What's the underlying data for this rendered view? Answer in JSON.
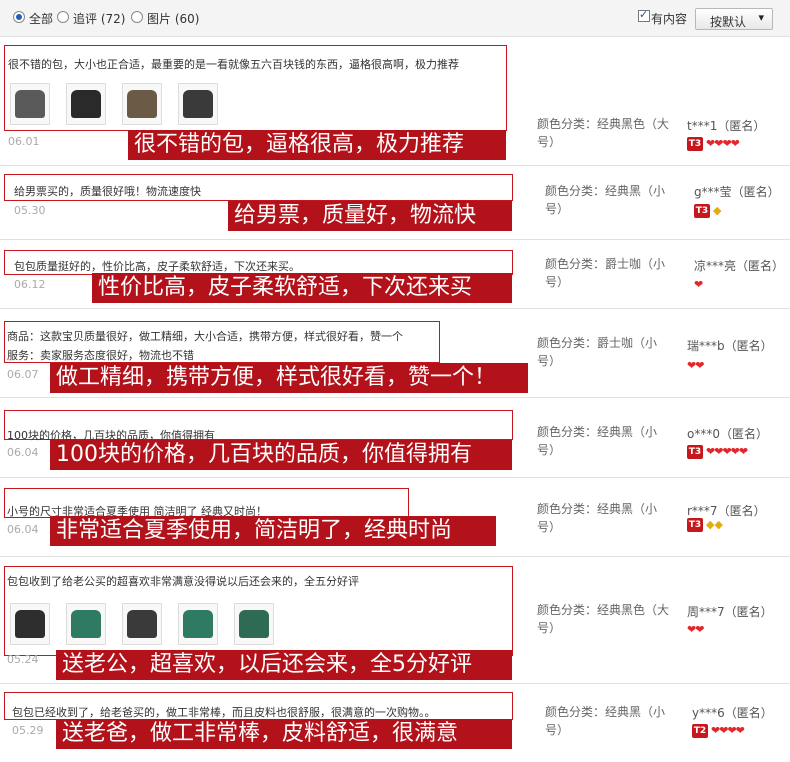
{
  "filters": {
    "all_label": "全部",
    "followup_label": "追评 (72)",
    "pictures_label": "图片 (60)",
    "has_content_label": "有内容",
    "sort_label": "按默认"
  },
  "reviews": [
    {
      "text": "很不错的包，大小也正合适，最重要的是一看就像五六百块钱的东西，逼格很高啊，极力推荐",
      "date": "06.01",
      "banner": "很不错的包，逼格很高，极力推荐",
      "sku_key": "颜色分类：",
      "sku_value": "经典黑色（大号）",
      "buyer": "t***1（匿名）",
      "tier": "T3",
      "hearts": 4,
      "diamonds": 0
    },
    {
      "text": "给男票买的，质量很好哦！物流速度快",
      "date": "05.30",
      "banner": "给男票，质量好，物流快",
      "sku_key": "颜色分类：",
      "sku_value": "经典黑（小号）",
      "buyer": "g***莹（匿名）",
      "tier": "T3",
      "hearts": 0,
      "diamonds": 1
    },
    {
      "text": "包包质量挺好的，性价比高，皮子柔软舒适，下次还来买。",
      "date": "06.12",
      "banner": "性价比高，皮子柔软舒适，下次还来买",
      "sku_key": "颜色分类：",
      "sku_value": "爵士咖（小号）",
      "buyer": "凉***亮（匿名）",
      "tier": "",
      "hearts": 1,
      "diamonds": 0
    },
    {
      "text": "商品：这款宝贝质量很好，做工精细，大小合适，携带方便，样式很好看，赞一个",
      "text2": "服务：卖家服务态度很好，物流也不错",
      "date": "06.07",
      "banner": "做工精细，携带方便，样式很好看，赞一个！",
      "sku_key": "颜色分类：",
      "sku_value": "爵士咖（小号）",
      "buyer": "瑞***b（匿名）",
      "tier": "",
      "hearts": 2,
      "diamonds": 0
    },
    {
      "text": "100块的价格，几百块的品质，你值得拥有",
      "date": "06.04",
      "banner": "100块的价格，几百块的品质，你值得拥有",
      "sku_key": "颜色分类：",
      "sku_value": "经典黑（小号）",
      "buyer": "o***0（匿名）",
      "tier": "T3",
      "hearts": 5,
      "diamonds": 0
    },
    {
      "text": "小号的尺寸非常适合夏季使用 简洁明了 经典又时尚！",
      "date": "06.04",
      "banner": "非常适合夏季使用，简洁明了，经典时尚",
      "sku_key": "颜色分类：",
      "sku_value": "经典黑（小号）",
      "buyer": "r***7（匿名）",
      "tier": "T3",
      "hearts": 0,
      "diamonds": 2
    },
    {
      "text": "包包收到了给老公买的超喜欢非常满意没得说以后还会来的，全五分好评",
      "date": "05.24",
      "banner": "送老公，超喜欢，以后还会来，全5分好评",
      "sku_key": "颜色分类：",
      "sku_value": "经典黑色（大号）",
      "buyer": "周***7（匿名）",
      "tier": "",
      "hearts": 2,
      "diamonds": 0
    },
    {
      "text": "包包已经收到了，给老爸买的，做工非常棒，而且皮料也很舒服，很满意的一次购物。。",
      "date": "05.29",
      "banner": "送老爸，做工非常棒，皮料舒适，很满意",
      "sku_key": "颜色分类：",
      "sku_value": "经典黑（小号）",
      "buyer": "y***6（匿名）",
      "tier": "T2",
      "hearts": 4,
      "diamonds": 0
    }
  ],
  "colors": {
    "accent_red": "#b3121a",
    "heart": "#e3262b",
    "diamond": "#e2ac0c",
    "link_blue": "#1f5fbf"
  },
  "icons": {
    "radio": "radio-button",
    "checkbox": "checkbox",
    "sort": "chevron-down-icon",
    "heart": "heart-icon",
    "diamond": "diamond-icon",
    "tier": "tier-badge-icon"
  }
}
